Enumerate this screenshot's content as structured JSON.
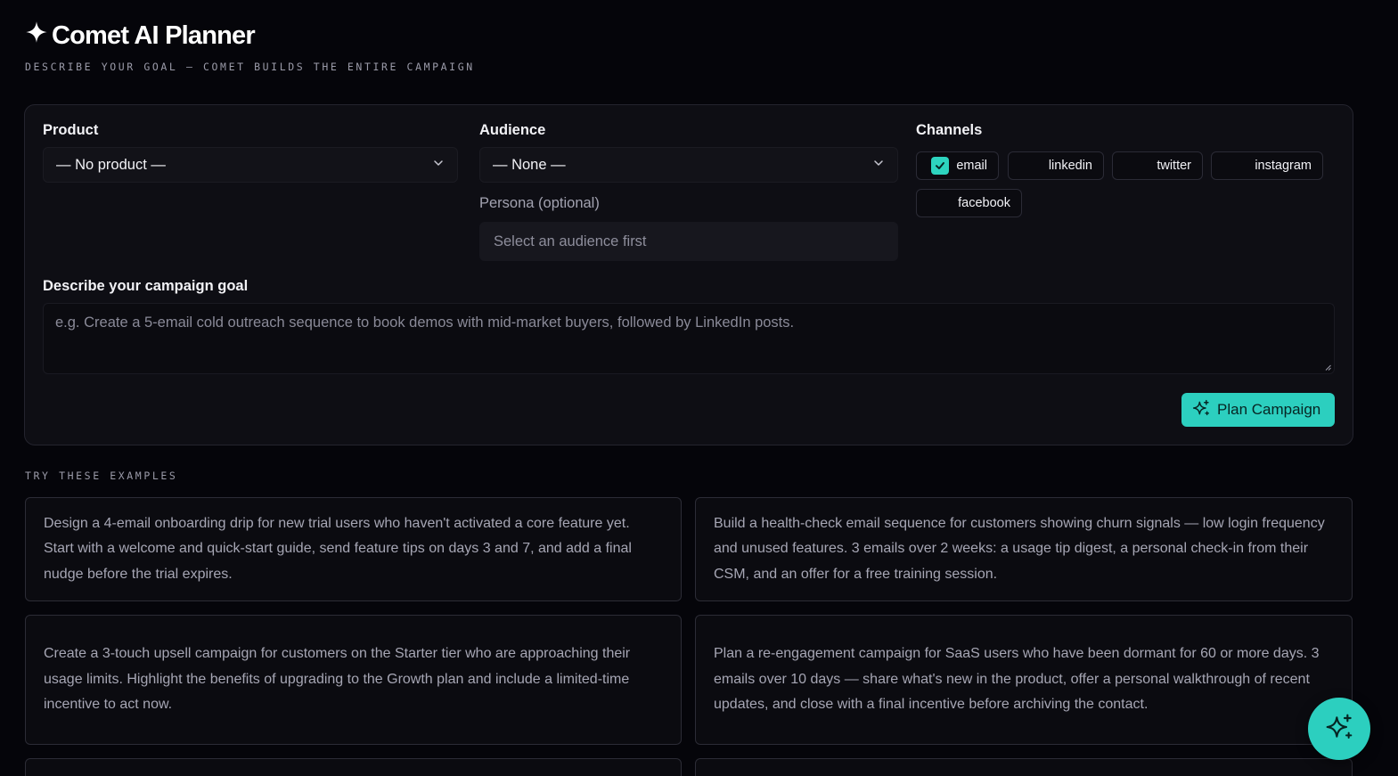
{
  "app": {
    "title": "Comet AI Planner",
    "subtitle": "DESCRIBE YOUR GOAL — COMET BUILDS THE ENTIRE CAMPAIGN"
  },
  "form": {
    "product": {
      "label": "Product",
      "value": "— No product —"
    },
    "audience": {
      "label": "Audience",
      "value": "— None —"
    },
    "persona": {
      "label": "Persona (optional)",
      "placeholder": "Select an audience first"
    },
    "channels": {
      "label": "Channels",
      "items": [
        {
          "name": "email",
          "checked": true
        },
        {
          "name": "linkedin",
          "checked": false
        },
        {
          "name": "twitter",
          "checked": false
        },
        {
          "name": "instagram",
          "checked": false
        },
        {
          "name": "facebook",
          "checked": false
        }
      ]
    },
    "goal": {
      "label": "Describe your campaign goal",
      "placeholder": "e.g. Create a 5-email cold outreach sequence to book demos with mid-market buyers, followed by LinkedIn posts."
    },
    "plan_button": "Plan Campaign"
  },
  "examples": {
    "title": "TRY THESE EXAMPLES",
    "items": [
      "Design a 4-email onboarding drip for new trial users who haven't activated a core feature yet. Start with a welcome and quick-start guide, send feature tips on days 3 and 7, and add a final nudge before the trial expires.",
      "Build a health-check email sequence for customers showing churn signals — low login frequency and unused features. 3 emails over 2 weeks: a usage tip digest, a personal check-in from their CSM, and an offer for a free training session.",
      "Create a 3-touch upsell campaign for customers on the Starter tier who are approaching their usage limits. Highlight the benefits of upgrading to the Growth plan and include a limited-time incentive to act now.",
      "Plan a re-engagement campaign for SaaS users who have been dormant for 60 or more days. 3 emails over 10 days — share what's new in the product, offer a personal walkthrough of recent updates, and close with a final incentive before archiving the contact."
    ]
  },
  "icons": {
    "title": "sparkle-icon",
    "select": "chevron-down-icon",
    "check": "check-icon",
    "plan": "sparkles-icon",
    "fab": "sparkles-icon"
  },
  "colors": {
    "accent": "#2ccfbf",
    "background": "#05050a",
    "card": "#0e0e14"
  }
}
